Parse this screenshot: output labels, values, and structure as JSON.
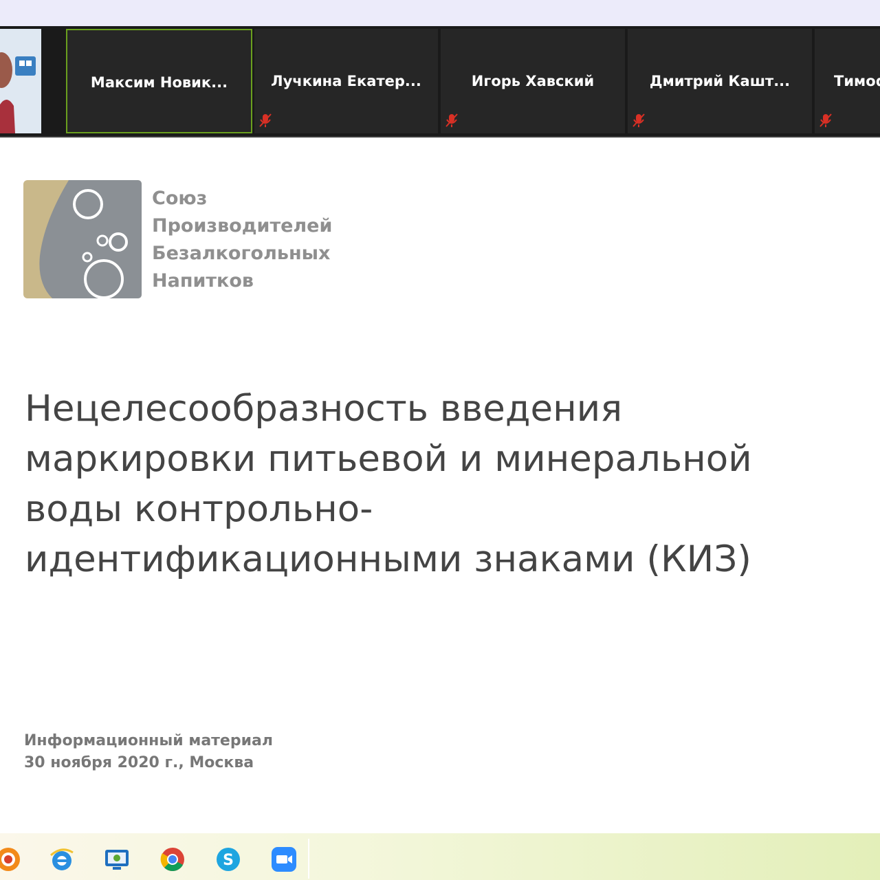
{
  "meeting": {
    "participants": [
      {
        "name": "Максим  Новик...",
        "active": true,
        "muted": false
      },
      {
        "name": "Лучкина  Екатер...",
        "active": false,
        "muted": true
      },
      {
        "name": "Игорь Хавский",
        "active": false,
        "muted": true
      },
      {
        "name": "Дмитрий  Кашт...",
        "active": false,
        "muted": true
      },
      {
        "name": "Тимоф",
        "active": false,
        "muted": true
      }
    ],
    "accent_color": "#6aa01e",
    "muted_icon_color": "#d93025"
  },
  "slide": {
    "org_name": [
      "Союз",
      "Производителей",
      "Безалкогольных",
      "Напитков"
    ],
    "title_lines": [
      "Нецелесообразность введения",
      "маркировки питьевой и минеральной",
      "воды контрольно-",
      "идентификационными знаками (КИЗ)"
    ],
    "footer_line1": "Информационный материал",
    "footer_line2": "30 ноября 2020 г., Москва",
    "logo_colors": {
      "gold": "#c9b88a",
      "gray": "#8b9095"
    }
  },
  "taskbar": {
    "icons": [
      "app-icon",
      "internet-explorer-icon",
      "monitor-app-icon",
      "chrome-icon",
      "skype-icon",
      "zoom-icon"
    ]
  }
}
